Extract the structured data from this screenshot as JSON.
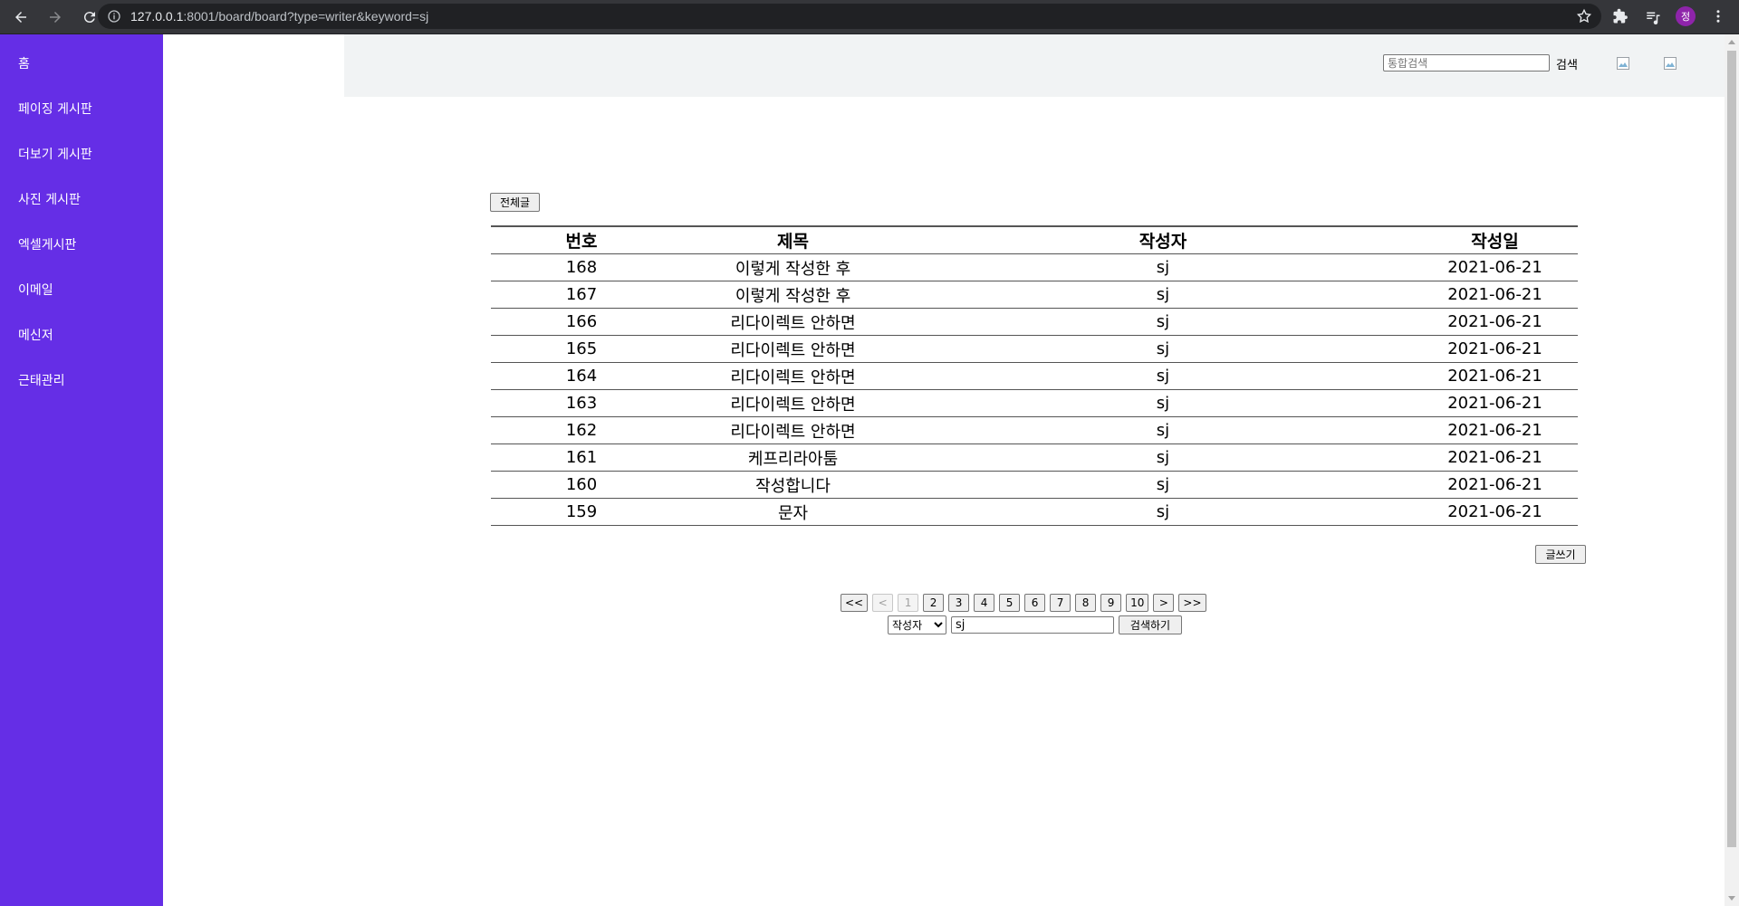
{
  "browser": {
    "url_host": "127.0.0.1",
    "url_rest": ":8001/board/board?type=writer&keyword=sj",
    "avatar_letter": "정"
  },
  "sidebar": {
    "items": [
      {
        "label": "홈"
      },
      {
        "label": "페이징 게시판"
      },
      {
        "label": "더보기 게시판"
      },
      {
        "label": "사진 게시판"
      },
      {
        "label": "엑셀게시판"
      },
      {
        "label": "이메일"
      },
      {
        "label": "메신저"
      },
      {
        "label": "근태관리"
      }
    ]
  },
  "header": {
    "search_placeholder": "통합검색",
    "search_label": "검색"
  },
  "board": {
    "all_button": "전체글",
    "write_button": "글쓰기",
    "columns": [
      "번호",
      "제목",
      "작성자",
      "작성일"
    ],
    "rows": [
      {
        "no": "168",
        "title": "이렇게 작성한 후",
        "writer": "sj",
        "date": "2021-06-21"
      },
      {
        "no": "167",
        "title": "이렇게 작성한 후",
        "writer": "sj",
        "date": "2021-06-21"
      },
      {
        "no": "166",
        "title": "리다이렉트 안하면",
        "writer": "sj",
        "date": "2021-06-21"
      },
      {
        "no": "165",
        "title": "리다이렉트 안하면",
        "writer": "sj",
        "date": "2021-06-21"
      },
      {
        "no": "164",
        "title": "리다이렉트 안하면",
        "writer": "sj",
        "date": "2021-06-21"
      },
      {
        "no": "163",
        "title": "리다이렉트 안하면",
        "writer": "sj",
        "date": "2021-06-21"
      },
      {
        "no": "162",
        "title": "리다이렉트 안하면",
        "writer": "sj",
        "date": "2021-06-21"
      },
      {
        "no": "161",
        "title": "케프리라아툼",
        "writer": "sj",
        "date": "2021-06-21"
      },
      {
        "no": "160",
        "title": "작성합니다",
        "writer": "sj",
        "date": "2021-06-21"
      },
      {
        "no": "159",
        "title": "문자",
        "writer": "sj",
        "date": "2021-06-21"
      }
    ]
  },
  "pagination": {
    "buttons": [
      {
        "label": "<<",
        "disabled": false
      },
      {
        "label": "<",
        "disabled": true
      },
      {
        "label": "1",
        "disabled": true
      },
      {
        "label": "2",
        "disabled": false
      },
      {
        "label": "3",
        "disabled": false
      },
      {
        "label": "4",
        "disabled": false
      },
      {
        "label": "5",
        "disabled": false
      },
      {
        "label": "6",
        "disabled": false
      },
      {
        "label": "7",
        "disabled": false
      },
      {
        "label": "8",
        "disabled": false
      },
      {
        "label": "9",
        "disabled": false
      },
      {
        "label": "10",
        "disabled": false
      },
      {
        "label": ">",
        "disabled": false
      },
      {
        "label": ">>",
        "disabled": false
      }
    ]
  },
  "search": {
    "selected_type": "작성자",
    "keyword": "sj",
    "button": "검색하기"
  },
  "colors": {
    "sidebar": "#652ee6",
    "topbar": "#f1f3f4"
  }
}
